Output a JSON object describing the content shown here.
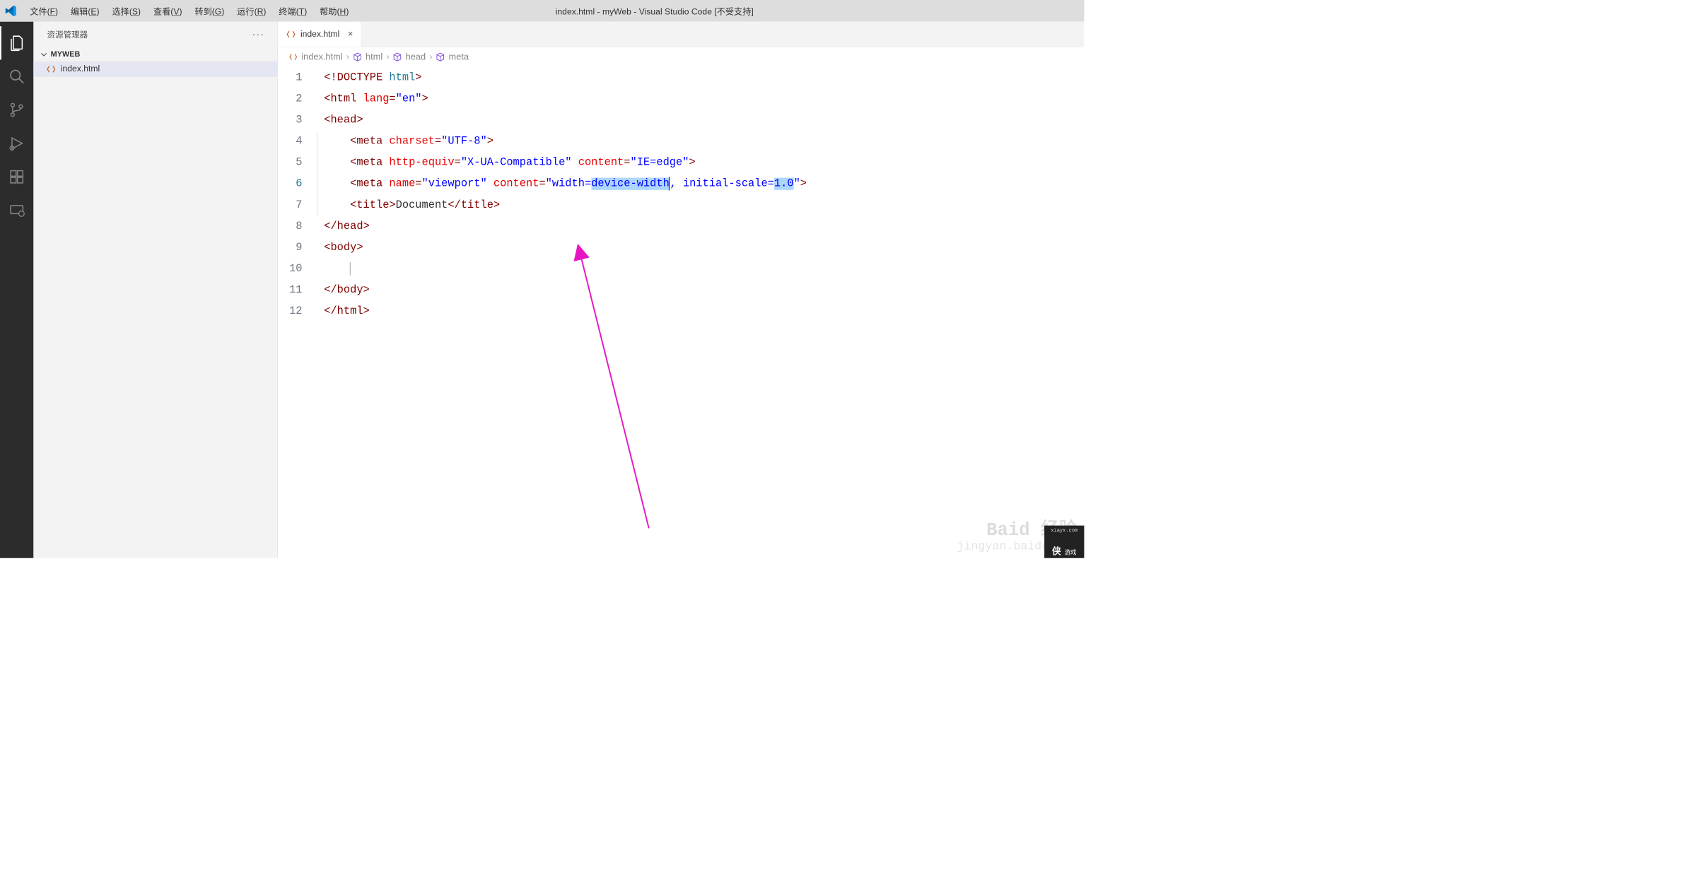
{
  "title": "index.html - myWeb - Visual Studio Code [不受支持]",
  "menu": [
    {
      "label": "文件",
      "key": "F"
    },
    {
      "label": "编辑",
      "key": "E"
    },
    {
      "label": "选择",
      "key": "S"
    },
    {
      "label": "查看",
      "key": "V"
    },
    {
      "label": "转到",
      "key": "G"
    },
    {
      "label": "运行",
      "key": "R"
    },
    {
      "label": "终端",
      "key": "T"
    },
    {
      "label": "帮助",
      "key": "H"
    }
  ],
  "sidebar": {
    "title": "资源管理器",
    "folder": "MYWEB",
    "file": "index.html"
  },
  "tab": {
    "label": "index.html"
  },
  "breadcrumb": {
    "items": [
      "index.html",
      "html",
      "head",
      "meta"
    ]
  },
  "line_numbers": [
    "1",
    "2",
    "3",
    "4",
    "5",
    "6",
    "7",
    "8",
    "9",
    "10",
    "11",
    "12"
  ],
  "active_line": 6,
  "code": {
    "l1": {
      "doctype": "DOCTYPE",
      "kw": "html"
    },
    "l2": {
      "tag": "html",
      "attr": "lang",
      "val": "\"en\""
    },
    "l3": {
      "tag": "head"
    },
    "l4": {
      "tag": "meta",
      "attr": "charset",
      "val": "\"UTF-8\""
    },
    "l5": {
      "tag": "meta",
      "attr1": "http-equiv",
      "val1": "\"X-UA-Compatible\"",
      "attr2": "content",
      "val2": "\"IE=edge\""
    },
    "l6": {
      "tag": "meta",
      "attr1": "name",
      "val1": "\"viewport\"",
      "attr2": "content",
      "val2a": "\"width=",
      "sel1": "device-width",
      "mid": ", initial-scale=",
      "sel2": "1.0",
      "end": "\""
    },
    "l7": {
      "tag": "title",
      "text": "Document"
    },
    "l8": {
      "tag": "head"
    },
    "l9": {
      "tag": "body"
    },
    "l11": {
      "tag": "body"
    },
    "l12": {
      "tag": "html"
    }
  },
  "watermark": {
    "line1": "Baid 经验",
    "line2": "jingyan.baidu.com"
  },
  "corner": {
    "url": "xiayx.com",
    "char": "侠",
    "label": "游戏"
  }
}
